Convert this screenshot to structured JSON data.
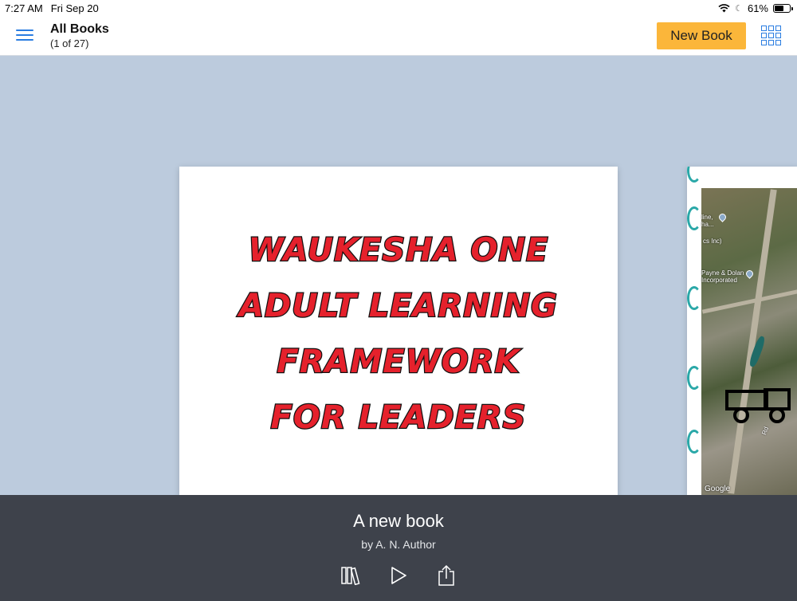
{
  "status_bar": {
    "time": "7:27 AM",
    "date": "Fri Sep 20",
    "battery": "61%",
    "battery_level": 0.61
  },
  "header": {
    "title": "All Books",
    "subtitle": "(1 of 27)",
    "new_book_label": "New Book",
    "accent_color": "#2a7de1",
    "button_color": "#fbb63a"
  },
  "current_book": {
    "cover_lines": [
      "Waukesha One",
      "Adult Learning",
      "Framework",
      "For Leaders"
    ],
    "title": "A new book",
    "author": "by A. N. Author"
  },
  "next_book": {
    "map_labels": [
      "line,",
      "ha...",
      "cs Inc)",
      "Payne & Dolan",
      "Incorporated",
      "Rd"
    ],
    "map_credit": "Google"
  },
  "icons": {
    "menu": "hamburger-icon",
    "grid": "grid-view-icon",
    "library": "library-icon",
    "play": "play-icon",
    "share": "share-icon"
  }
}
